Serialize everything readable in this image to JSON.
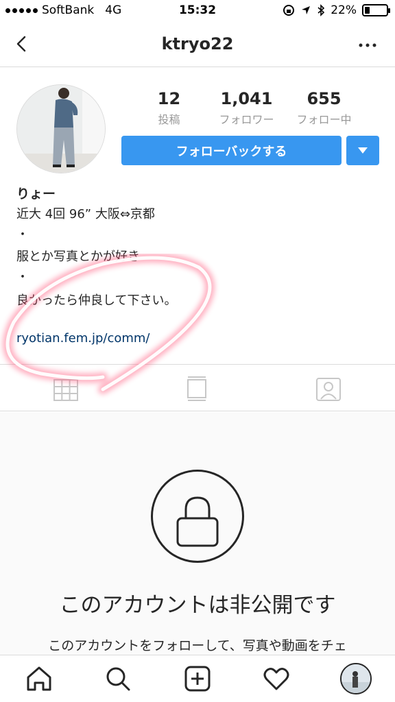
{
  "status_bar": {
    "carrier": "SoftBank",
    "network": "4G",
    "time": "15:32",
    "battery": "22%",
    "battery_level": 0.22
  },
  "header": {
    "username": "ktryo22",
    "back_icon": "chevron-left-icon",
    "more_icon": "more-horizontal-icon"
  },
  "profile": {
    "stats": [
      {
        "value": "12",
        "label": "投稿"
      },
      {
        "value": "1,041",
        "label": "フォロワー"
      },
      {
        "value": "655",
        "label": "フォロー中"
      }
    ],
    "follow_button": "フォローバックする",
    "display_name": "りょー",
    "bio_lines": [
      "近大 4回 96” 大阪⇔京都",
      "・",
      "服とか写真とかが好き",
      "・",
      "良かったら仲良して下さい。"
    ],
    "link": "ryotian.fem.jp/comm/"
  },
  "tabs": [
    {
      "name": "grid",
      "icon": "grid-icon",
      "active": true
    },
    {
      "name": "feed",
      "icon": "feed-icon",
      "active": false
    },
    {
      "name": "tagged",
      "icon": "tagged-person-icon",
      "active": false
    }
  ],
  "private": {
    "title": "このアカウントは非公開です",
    "description": "このアカウントをフォローして、写真や動画をチェ"
  },
  "bottom_nav": [
    {
      "name": "home",
      "icon": "home-icon"
    },
    {
      "name": "search",
      "icon": "search-icon"
    },
    {
      "name": "add",
      "icon": "add-post-icon"
    },
    {
      "name": "activity",
      "icon": "heart-icon"
    },
    {
      "name": "profile",
      "icon": "profile-avatar"
    }
  ],
  "colors": {
    "accent": "#3897f0",
    "link": "#003569",
    "text": "#262626",
    "muted": "#999999",
    "border": "#dbdbdb",
    "annotation": "#ff5a7a"
  }
}
